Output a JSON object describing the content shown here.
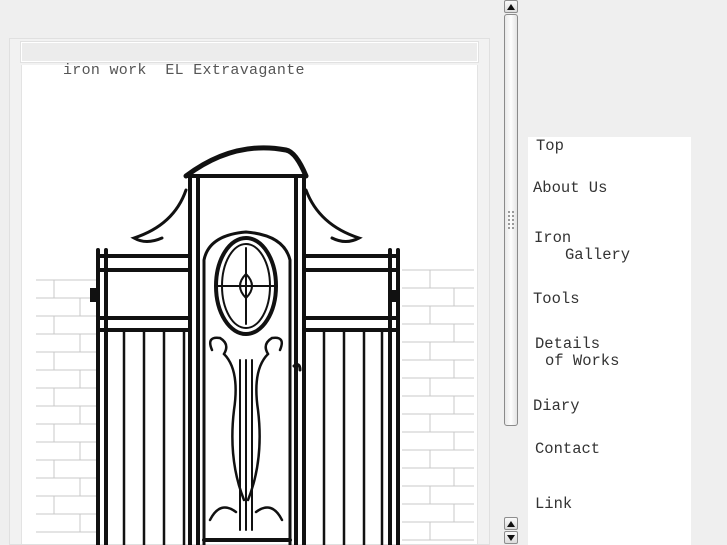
{
  "site": {
    "title": "iron work  EL Extravagante"
  },
  "nav": {
    "top": "Top",
    "about": "About Us",
    "gallery_line1": "Iron",
    "gallery_line2": "Gallery",
    "tools": "Tools",
    "details_line1": "Details",
    "details_line2": "of Works",
    "diary": "Diary",
    "contact": "Contact",
    "link": "Link"
  },
  "icons": {
    "scroll_up": "arrow-up-icon",
    "scroll_down": "arrow-down-icon",
    "grip": "grip-icon"
  },
  "colors": {
    "background": "#efefef",
    "content": "#ffffff",
    "text": "#333333",
    "iron": "#111111"
  }
}
